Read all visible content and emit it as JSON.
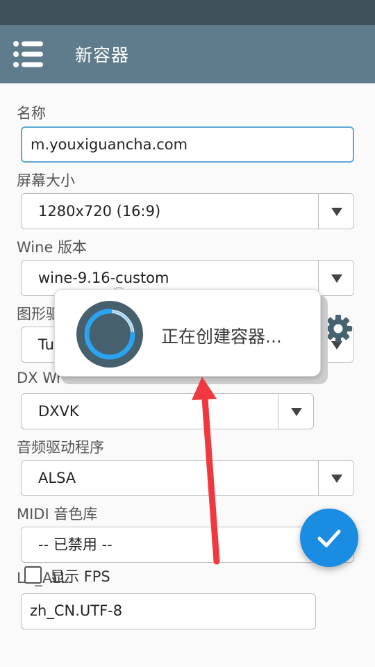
{
  "app_bar": {
    "title": "新容器"
  },
  "form": {
    "name": {
      "label": "名称",
      "value": "m.youxiguancha.com"
    },
    "screen_size": {
      "label": "屏幕大小",
      "value": "1280x720 (16:9)"
    },
    "wine_version": {
      "label": "Wine 版本",
      "value": "wine-9.16-custom"
    },
    "graphics_driver": {
      "label": "图形驱",
      "value": "Tu"
    },
    "dx_wrapper": {
      "label": "DX Wr",
      "value": "DXVK"
    },
    "audio_driver": {
      "label": "音频驱动程序",
      "value": "ALSA"
    },
    "midi_soundfont": {
      "label": "MIDI 音色库",
      "value": "-- 已禁用 --"
    },
    "lc_all": {
      "label": "LC_ALL",
      "value": "zh_CN.UTF-8"
    },
    "show_fps": {
      "label": "显示 FPS",
      "checked": false
    }
  },
  "dialog": {
    "message": "正在创建容器..."
  },
  "colors": {
    "status_bar": "#3f525c",
    "app_bar": "#5e7c8b",
    "accent": "#1a8de3",
    "annotation_arrow": "#f0393f"
  },
  "icons": {
    "menu": "menu-list-icon",
    "gear": "gear-icon",
    "fab": "check-icon",
    "spinner": "loading-spinner-icon"
  }
}
